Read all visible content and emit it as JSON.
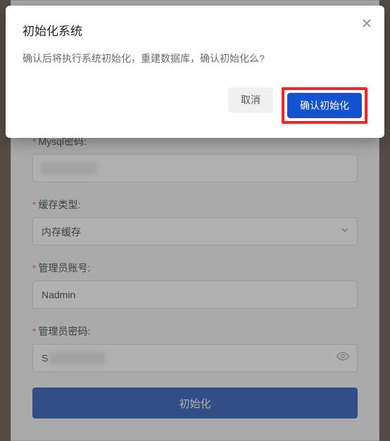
{
  "dialog": {
    "title": "初始化系统",
    "message": "确认后将执行系统初始化，重建数据库，确认初始化么?",
    "cancel_label": "取消",
    "confirm_label": "确认初始化"
  },
  "form": {
    "fields": {
      "mysql_password": {
        "label": "Mysql密码:",
        "value": ""
      },
      "cache_type": {
        "label": "缓存类型:",
        "selected": "内存缓存"
      },
      "admin_account": {
        "label": "管理员账号:",
        "value": "Nadmin"
      },
      "admin_password": {
        "label": "管理员密码:",
        "value": "S"
      }
    },
    "submit_label": "初始化"
  }
}
